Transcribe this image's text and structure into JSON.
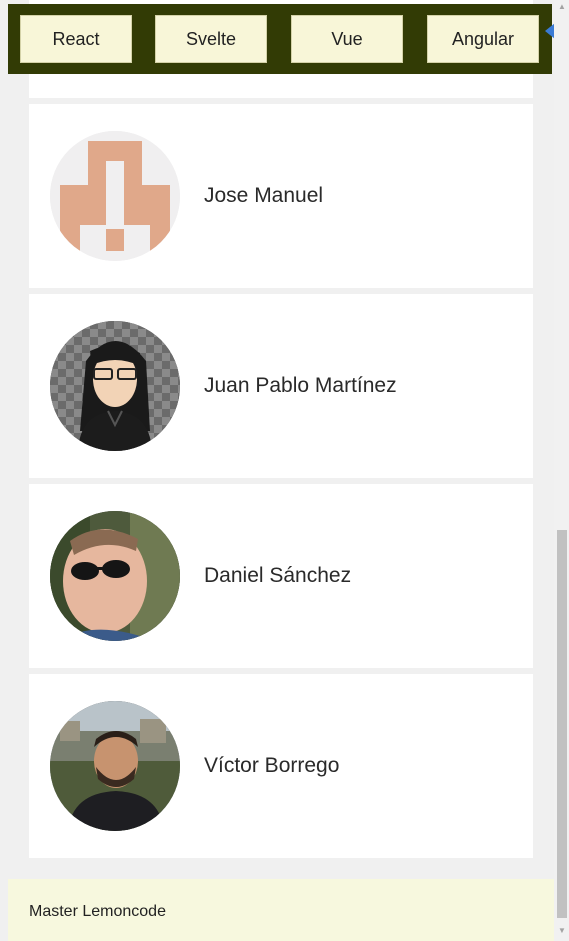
{
  "nav": {
    "buttons": [
      {
        "label": "React"
      },
      {
        "label": "Svelte"
      },
      {
        "label": "Vue"
      },
      {
        "label": "Angular"
      }
    ]
  },
  "members": [
    {
      "name": "Jose Manuel",
      "avatar": "identicon-avatar"
    },
    {
      "name": "Juan Pablo Martínez",
      "avatar": "cartoon-avatar"
    },
    {
      "name": "Daniel Sánchez",
      "avatar": "photo-avatar-sunglasses"
    },
    {
      "name": "Víctor Borrego",
      "avatar": "photo-avatar-outdoor"
    }
  ],
  "footer": {
    "text": "Master Lemoncode"
  },
  "colors": {
    "nav_bg": "#323b05",
    "button_bg": "#f8f6d8",
    "footer_bg": "#f7f8de",
    "card_bg": "#ffffff",
    "page_bg": "#f0f0f0",
    "arrow": "#3a7bd5"
  }
}
